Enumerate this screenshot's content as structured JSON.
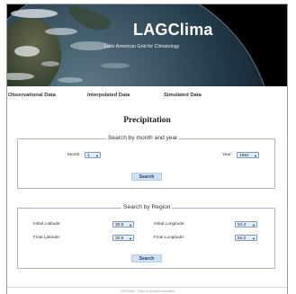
{
  "banner": {
    "title": "LAGClima",
    "subtitle": "Latin American Grid for Climatology"
  },
  "nav": {
    "items": [
      {
        "label": "Observational Data"
      },
      {
        "label": "Interpolated Data"
      },
      {
        "label": "Simulated Data"
      }
    ]
  },
  "page": {
    "heading": "Precipitation"
  },
  "month_year": {
    "legend": "Search by month and year",
    "month_label": "Month:",
    "month_value": "1",
    "year_label": "Year:",
    "year_value": "1991",
    "search_label": "Search"
  },
  "region": {
    "legend": "Search by Region",
    "initial_latitude_label": "Initial Latitude:",
    "initial_latitude_value": "30.5",
    "initial_longitude_label": "Initial Longitude:",
    "initial_longitude_value": "54.2",
    "final_latitude_label": "Final Latitude:",
    "final_latitude_value": "30.5",
    "final_longitude_label": "Final Longitude:",
    "final_longitude_value": "54.2",
    "search_label": "Search"
  },
  "footer": {
    "text": "LAGClima · Todos os direitos reservados"
  },
  "icons": {
    "dropdown": "chevron-down-icon"
  },
  "colors": {
    "banner_background": "#000000",
    "button_background": "#cfe0f3",
    "button_text": "#1d3f72",
    "select_background": "#e4ecf7",
    "fieldset_border": "#a8b4c4"
  }
}
